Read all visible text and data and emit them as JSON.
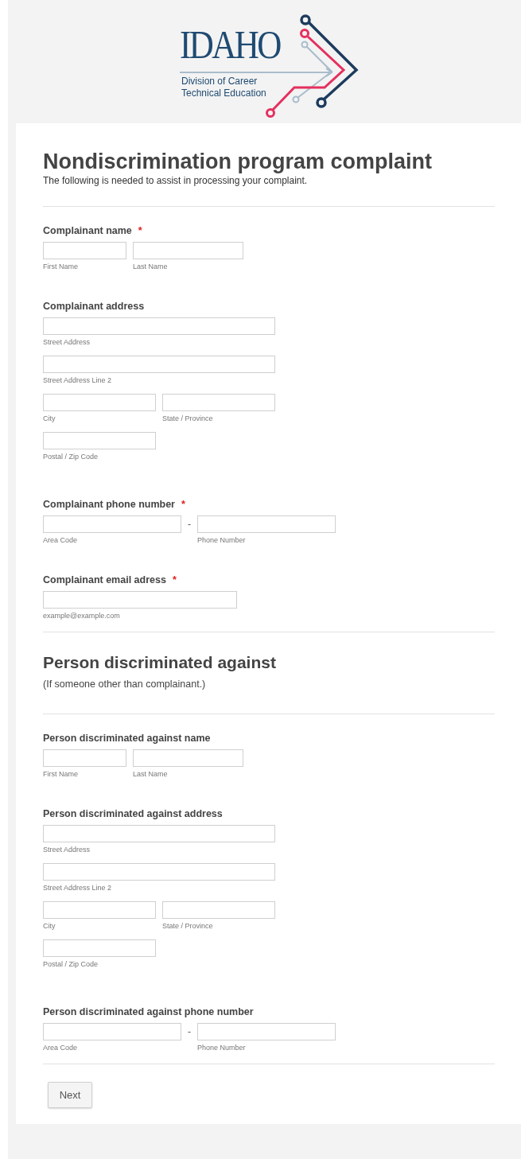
{
  "logo": {
    "wordmark": "IDAHO",
    "lines": [
      "Division of Career",
      "Technical Education"
    ]
  },
  "form": {
    "items": [
      {
        "kind": "title",
        "title": "Nondiscrimination program complaint",
        "description": "The following is needed to assist in processing your complaint."
      },
      {
        "kind": "divider"
      },
      {
        "kind": "question",
        "label": "Complainant name",
        "required_mark": "*",
        "rows": [
          [
            {
              "sublabel": "First Name",
              "kind": "first"
            },
            {
              "sublabel": "Last Name",
              "kind": "last"
            }
          ]
        ]
      },
      {
        "kind": "question",
        "label": "Complainant address",
        "rows": [
          [
            {
              "sublabel": "Street Address",
              "kind": "street"
            }
          ],
          [
            {
              "sublabel": "Street Address Line 2",
              "kind": "street"
            }
          ],
          [
            {
              "sublabel": "City",
              "kind": "city"
            },
            {
              "sublabel": "State / Province",
              "kind": "city"
            }
          ],
          [
            {
              "sublabel": "Postal / Zip Code",
              "kind": "city"
            }
          ]
        ]
      },
      {
        "kind": "question",
        "label": "Complainant phone number",
        "required_mark": "*",
        "separator": "-",
        "rows": [
          [
            {
              "sublabel": "Area Code",
              "kind": "phone"
            },
            {
              "sublabel": "Phone Number",
              "kind": "phone"
            }
          ]
        ]
      },
      {
        "kind": "question",
        "label": "Complainant email adress",
        "required_mark": "*",
        "rows": [
          [
            {
              "sublabel": "example@example.com",
              "kind": "email"
            }
          ]
        ]
      },
      {
        "kind": "divider"
      },
      {
        "kind": "section",
        "title": "Person discriminated against",
        "description": "(If someone other than complainant.)"
      },
      {
        "kind": "divider"
      },
      {
        "kind": "question",
        "label": "Person discriminated against name",
        "rows": [
          [
            {
              "sublabel": "First Name",
              "kind": "first"
            },
            {
              "sublabel": "Last Name",
              "kind": "last"
            }
          ]
        ]
      },
      {
        "kind": "question",
        "label": "Person discriminated against address",
        "rows": [
          [
            {
              "sublabel": "Street Address",
              "kind": "street"
            }
          ],
          [
            {
              "sublabel": "Street Address Line 2",
              "kind": "street"
            }
          ],
          [
            {
              "sublabel": "City",
              "kind": "city"
            },
            {
              "sublabel": "State / Province",
              "kind": "city"
            }
          ],
          [
            {
              "sublabel": "Postal / Zip Code",
              "kind": "city"
            }
          ]
        ]
      },
      {
        "kind": "question",
        "label": "Person discriminated against phone number",
        "separator": "-",
        "rows": [
          [
            {
              "sublabel": "Area Code",
              "kind": "phone"
            },
            {
              "sublabel": "Phone Number",
              "kind": "phone"
            }
          ]
        ]
      },
      {
        "kind": "divider"
      },
      {
        "kind": "button",
        "label": "Next"
      }
    ]
  }
}
